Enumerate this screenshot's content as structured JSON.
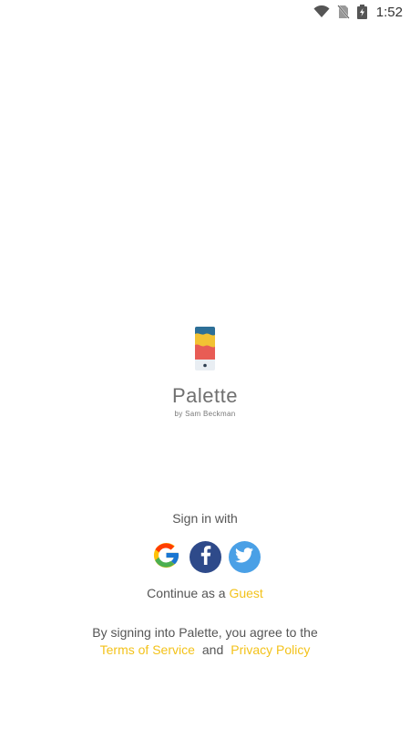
{
  "status_bar": {
    "time": "1:52"
  },
  "app": {
    "name": "Palette",
    "byline": "by Sam Beckman"
  },
  "signin": {
    "label": "Sign in with",
    "providers": [
      "google",
      "facebook",
      "twitter"
    ]
  },
  "guest": {
    "prefix": "Continue as a",
    "link": "Guest"
  },
  "legal": {
    "text": "By signing into Palette, you agree to the",
    "terms": "Terms of Service",
    "and": "and",
    "privacy": "Privacy Policy"
  },
  "colors": {
    "accent": "#f3c21a",
    "facebook": "#2e4a8a",
    "twitter": "#4aa0e6"
  }
}
